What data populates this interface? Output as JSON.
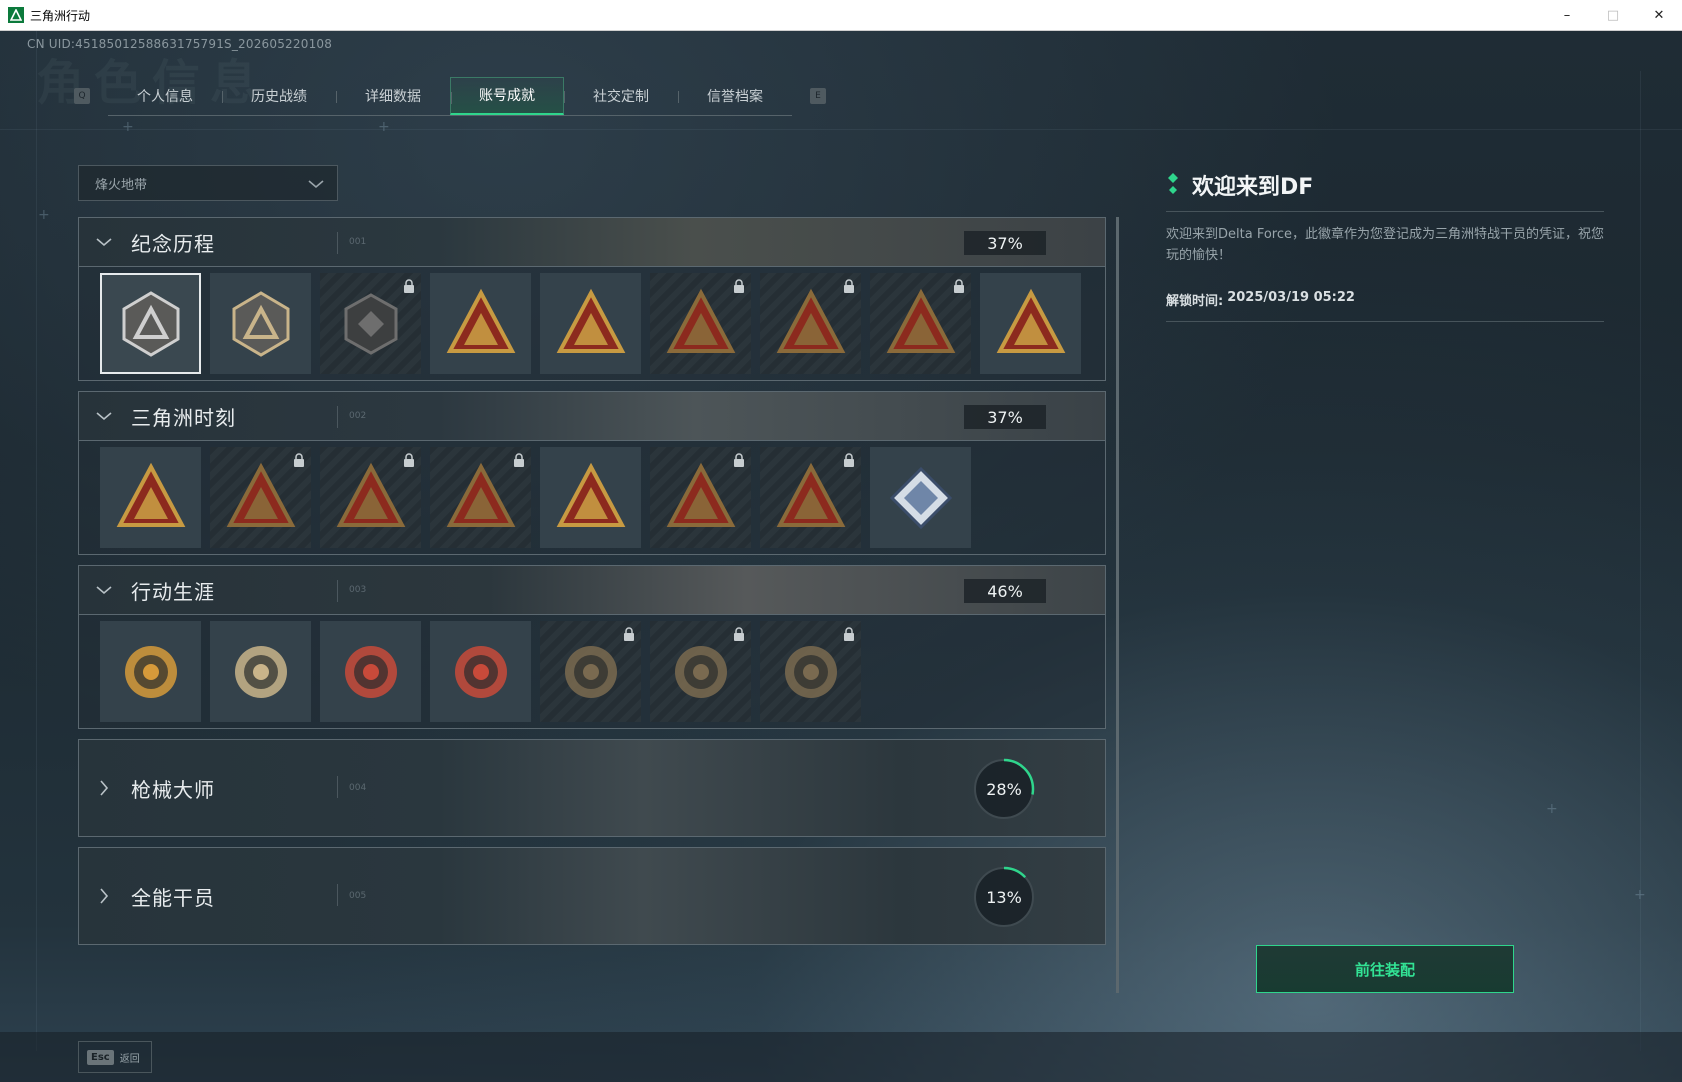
{
  "window": {
    "title": "三角洲行动",
    "minimize": "–",
    "maximize": "□",
    "close": "✕"
  },
  "uid": "CN UID:4518501258863175791S_202605220108",
  "bg_title": "角色信息",
  "tabbar": {
    "left_key": "Q",
    "right_key": "E",
    "tabs": [
      {
        "label": "个人信息",
        "active": false
      },
      {
        "label": "历史战绩",
        "active": false
      },
      {
        "label": "详细数据",
        "active": false
      },
      {
        "label": "账号成就",
        "active": true
      },
      {
        "label": "社交定制",
        "active": false
      },
      {
        "label": "信誉档案",
        "active": false
      }
    ]
  },
  "mode_select": {
    "value": "烽火地带"
  },
  "sections": [
    {
      "name": "纪念历程",
      "index": "001",
      "progress": "37%",
      "expanded": true,
      "badges": [
        {
          "icon": "delta-shield-emblem",
          "locked": false,
          "selected": true,
          "color": "#cfcfcf"
        },
        {
          "icon": "helicopter-emblem",
          "locked": false,
          "selected": false,
          "color": "#c9b48a"
        },
        {
          "icon": "hex-shield-emblem",
          "locked": true,
          "selected": false,
          "color": "#6e6e6e"
        },
        {
          "icon": "bag-55-emblem",
          "locked": false,
          "selected": false,
          "color": "#c79a42"
        },
        {
          "icon": "box-57-emblem",
          "locked": false,
          "selected": false,
          "color": "#c79a42"
        },
        {
          "icon": "soldier-emblem",
          "locked": true,
          "selected": false,
          "color": "#8a6a3a"
        },
        {
          "icon": "woman-emblem",
          "locked": true,
          "selected": false,
          "color": "#8a6a3a"
        },
        {
          "icon": "skull-emblem",
          "locked": true,
          "selected": false,
          "color": "#8a6a3a"
        },
        {
          "icon": "number-one-emblem",
          "locked": false,
          "selected": false,
          "color": "#c79a42"
        }
      ]
    },
    {
      "name": "三角洲时刻",
      "index": "002",
      "progress": "37%",
      "expanded": true,
      "badges": [
        {
          "icon": "usb-emblem",
          "locked": false,
          "color": "#c79a42"
        },
        {
          "icon": "vase-emblem",
          "locked": true,
          "color": "#8a6a3a"
        },
        {
          "icon": "operator-emblem",
          "locked": true,
          "color": "#8a6a3a"
        },
        {
          "icon": "gear-emblem",
          "locked": true,
          "color": "#8a6a3a"
        },
        {
          "icon": "squad-emblem",
          "locked": false,
          "color": "#c79a42"
        },
        {
          "icon": "beast-emblem",
          "locked": true,
          "color": "#8a6a3a"
        },
        {
          "icon": "fish-emblem",
          "locked": true,
          "color": "#8a6a3a"
        },
        {
          "icon": "crystal-book-emblem",
          "locked": false,
          "color": "#9ab0c8"
        }
      ]
    },
    {
      "name": "行动生涯",
      "index": "003",
      "progress": "46%",
      "expanded": true,
      "badges": [
        {
          "icon": "star-medal-emblem",
          "locked": false,
          "color": "#d69a3a"
        },
        {
          "icon": "shield-medal-emblem",
          "locked": false,
          "color": "#c9b48a"
        },
        {
          "icon": "red-shield-medal-emblem",
          "locked": false,
          "color": "#c84a3a"
        },
        {
          "icon": "gold-shield-medal-emblem",
          "locked": false,
          "color": "#c84a3a"
        },
        {
          "icon": "ring-emblem",
          "locked": true,
          "color": "#7a6a50"
        },
        {
          "icon": "crosshair-skull-emblem",
          "locked": true,
          "color": "#7a6a50"
        },
        {
          "icon": "eye-emblem",
          "locked": true,
          "color": "#7a6a50"
        }
      ]
    },
    {
      "name": "枪械大师",
      "index": "004",
      "progress": "28%",
      "progress_value": 0.28,
      "expanded": false
    },
    {
      "name": "全能干员",
      "index": "005",
      "progress": "13%",
      "progress_value": 0.13,
      "expanded": false
    }
  ],
  "detail": {
    "title": "欢迎来到DF",
    "description": "欢迎来到Delta Force，此徽章作为您登记成为三角洲特战干员的凭证，祝您玩的愉快！",
    "unlock_label": "解锁时间:",
    "unlock_time": "2025/03/19 05:22",
    "action_button": "前往装配"
  },
  "footer": {
    "esc_key": "Esc",
    "esc_label": "返回"
  },
  "colors": {
    "accent": "#2fd58c",
    "panel_border": "#5b6870",
    "text": "#d8dde0"
  }
}
